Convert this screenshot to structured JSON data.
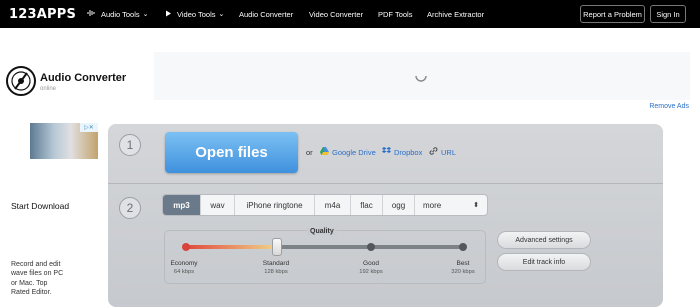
{
  "topbar": {
    "logo": "123APPS",
    "nav": [
      {
        "label": "Audio Tools",
        "icon": "waveform-icon",
        "dropdown": true
      },
      {
        "label": "Video Tools",
        "icon": "play-icon",
        "dropdown": true
      },
      {
        "label": "Audio Converter"
      },
      {
        "label": "Video Converter"
      },
      {
        "label": "PDF Tools"
      },
      {
        "label": "Archive Extractor"
      }
    ],
    "report_label": "Report a Problem",
    "signin_label": "Sign In"
  },
  "header": {
    "title": "Audio Converter",
    "subtitle": "online",
    "remove_ads": "Remove Ads"
  },
  "side_ad": {
    "cta": "Start Download",
    "description": "Record and edit wave files on PC or Mac. Top Rated Editor."
  },
  "step1": {
    "number": "1",
    "open_label": "Open files",
    "or_label": "or",
    "sources": [
      {
        "label": "Google Drive",
        "icon": "google-drive-icon"
      },
      {
        "label": "Dropbox",
        "icon": "dropbox-icon"
      },
      {
        "label": "URL",
        "icon": "link-icon"
      }
    ]
  },
  "step2": {
    "number": "2",
    "formats": [
      "mp3",
      "wav",
      "iPhone ringtone",
      "m4a",
      "flac",
      "ogg",
      "more"
    ],
    "selected_format": "mp3",
    "quality_title": "Quality",
    "quality_levels": [
      {
        "name": "Economy",
        "rate": "64 kbps"
      },
      {
        "name": "Standard",
        "rate": "128 kbps"
      },
      {
        "name": "Good",
        "rate": "192 kbps"
      },
      {
        "name": "Best",
        "rate": "320 kbps"
      }
    ],
    "selected_quality": "Standard",
    "advanced_label": "Advanced settings",
    "edit_track_label": "Edit track info"
  },
  "colors": {
    "accent": "#3f91dd",
    "link": "#2a6fc9",
    "topbar": "#000000"
  }
}
